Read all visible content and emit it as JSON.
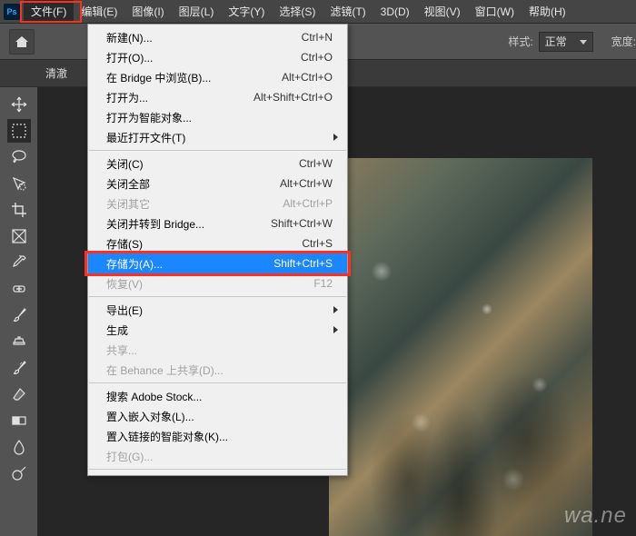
{
  "menubar": [
    "文件(F)",
    "编辑(E)",
    "图像(I)",
    "图层(L)",
    "文字(Y)",
    "选择(S)",
    "滤镜(T)",
    "3D(D)",
    "视图(V)",
    "窗口(W)",
    "帮助(H)"
  ],
  "optbar": {
    "style_label": "样式:",
    "style_value": "正常",
    "width_label": "宽度:"
  },
  "tab": "清澈",
  "dropdown": [
    {
      "t": "item",
      "label": "新建(N)...",
      "shortcut": "Ctrl+N"
    },
    {
      "t": "item",
      "label": "打开(O)...",
      "shortcut": "Ctrl+O"
    },
    {
      "t": "item",
      "label": "在 Bridge 中浏览(B)...",
      "shortcut": "Alt+Ctrl+O"
    },
    {
      "t": "item",
      "label": "打开为...",
      "shortcut": "Alt+Shift+Ctrl+O"
    },
    {
      "t": "item",
      "label": "打开为智能对象..."
    },
    {
      "t": "item",
      "label": "最近打开文件(T)",
      "submenu": true
    },
    {
      "t": "sep"
    },
    {
      "t": "item",
      "label": "关闭(C)",
      "shortcut": "Ctrl+W"
    },
    {
      "t": "item",
      "label": "关闭全部",
      "shortcut": "Alt+Ctrl+W"
    },
    {
      "t": "item",
      "label": "关闭其它",
      "shortcut": "Alt+Ctrl+P",
      "disabled": true
    },
    {
      "t": "item",
      "label": "关闭并转到 Bridge...",
      "shortcut": "Shift+Ctrl+W"
    },
    {
      "t": "item",
      "label": "存储(S)",
      "shortcut": "Ctrl+S"
    },
    {
      "t": "item",
      "label": "存储为(A)...",
      "shortcut": "Shift+Ctrl+S",
      "selected": true
    },
    {
      "t": "item",
      "label": "恢复(V)",
      "shortcut": "F12",
      "disabled": true
    },
    {
      "t": "sep"
    },
    {
      "t": "item",
      "label": "导出(E)",
      "submenu": true
    },
    {
      "t": "item",
      "label": "生成",
      "submenu": true
    },
    {
      "t": "item",
      "label": "共享...",
      "disabled": true
    },
    {
      "t": "item",
      "label": "在 Behance 上共享(D)...",
      "disabled": true
    },
    {
      "t": "sep"
    },
    {
      "t": "item",
      "label": "搜索 Adobe Stock..."
    },
    {
      "t": "item",
      "label": "置入嵌入对象(L)..."
    },
    {
      "t": "item",
      "label": "置入链接的智能对象(K)..."
    },
    {
      "t": "item",
      "label": "打包(G)...",
      "disabled": true
    },
    {
      "t": "sep"
    }
  ],
  "watermark": "wa.ne"
}
